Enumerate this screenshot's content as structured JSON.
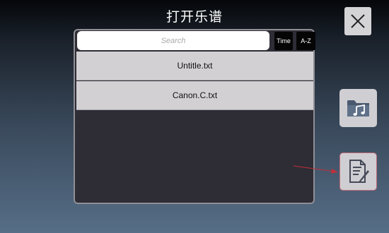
{
  "header": {
    "title": "打开乐谱"
  },
  "search": {
    "placeholder": "Search"
  },
  "sort": {
    "time_label": "Time",
    "az_label": "A-Z"
  },
  "files": [
    "Untitle.txt",
    "Canon.C.txt"
  ],
  "icons": {
    "close": "close-icon",
    "folder": "music-folder-icon",
    "edit": "edit-document-icon"
  },
  "colors": {
    "panel": "#2e2c35",
    "item": "#d3d0d4",
    "button": "#cfced2",
    "annotation_arrow": "#c0303c"
  }
}
